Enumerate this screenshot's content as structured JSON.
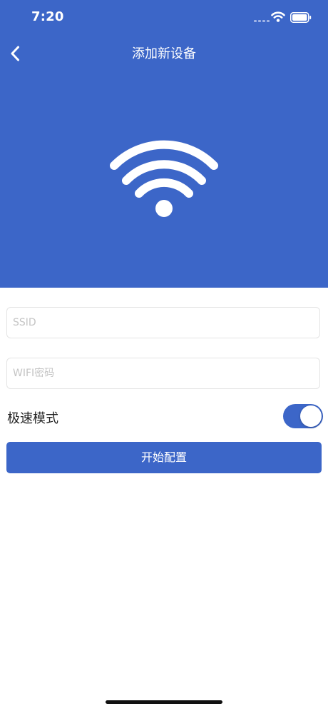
{
  "status_bar": {
    "time": "7:20"
  },
  "nav": {
    "title": "添加新设备",
    "back_icon": "chevron-left-icon"
  },
  "hero": {
    "icon": "wifi-icon",
    "background_color": "#3c66c8"
  },
  "form": {
    "ssid": {
      "value": "",
      "placeholder": "SSID"
    },
    "password": {
      "value": "",
      "placeholder": "WIFI密码"
    },
    "fast_mode": {
      "label": "极速模式",
      "enabled": true
    },
    "start_button": {
      "label": "开始配置"
    }
  },
  "colors": {
    "accent": "#3c66c8"
  }
}
